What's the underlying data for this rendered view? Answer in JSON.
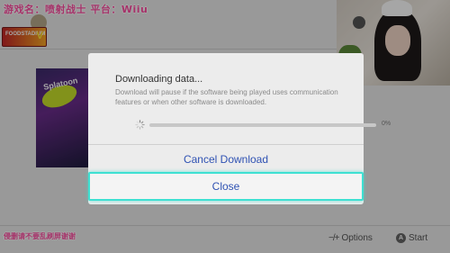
{
  "stream_overlay": {
    "top_text": "游戏名：喷射战士  平台：Wiiu",
    "bottom_text": "侵删请不要乱刷屏谢谢"
  },
  "logo": {
    "text": "FOODSTADIUM",
    "mark": "V"
  },
  "game_tile": {
    "title": "Splatoon",
    "subtitle": "Glob"
  },
  "dialog": {
    "title": "Downloading data...",
    "description": "Download will pause if the software being played uses communication features or when other software is downloaded.",
    "progress_percent": 0,
    "progress_label": "0%",
    "cancel_label": "Cancel Download",
    "close_label": "Close"
  },
  "footer": {
    "options_glyph": "−/+",
    "options_label": "Options",
    "start_glyph": "A",
    "start_label": "Start"
  },
  "colors": {
    "accent_blue": "#2f52b3",
    "focus_highlight": "#3ee0d2",
    "overlay_pink": "#ff4fa3"
  }
}
